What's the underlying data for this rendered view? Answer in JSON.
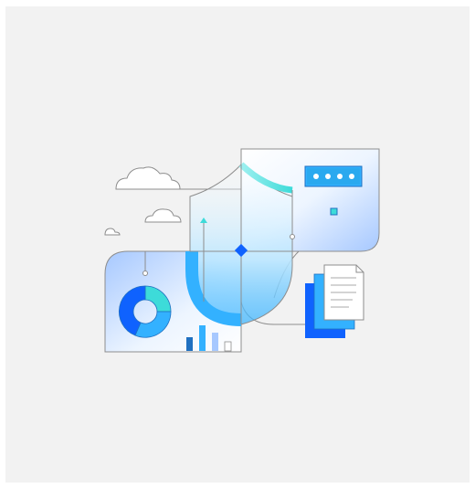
{
  "illustration": {
    "subject": "data-security-shield",
    "icons": [
      "cloud-icon",
      "shield-icon",
      "password-field-icon",
      "document-stack-icon",
      "donut-chart-icon",
      "bar-chart-icon",
      "arrow-up-icon",
      "lock-diamond-icon"
    ],
    "colors": {
      "background": "#f2f2f2",
      "accent_blue": "#1f70c1",
      "accent_cyan": "#33b1ff",
      "accent_teal": "#3ddbd9",
      "light_blue": "#a6c8ff",
      "deep_blue": "#0f62fe",
      "line": "#8d8d8d"
    },
    "password_dots": 4,
    "bar_chart_values": [
      0.35,
      0.65,
      0.5,
      0.22
    ]
  }
}
